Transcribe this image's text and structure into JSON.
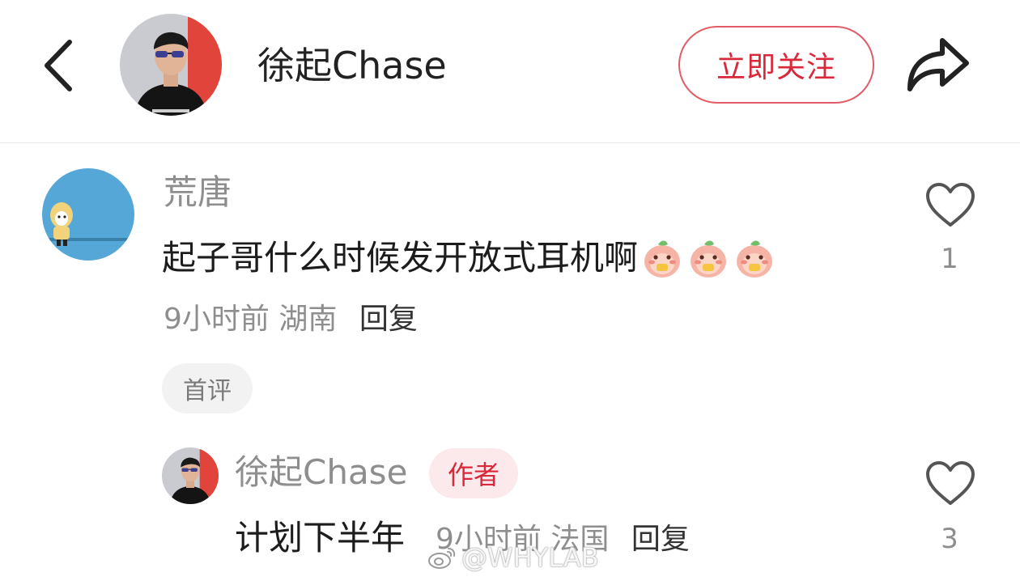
{
  "header": {
    "author_name": "徐起Chase",
    "follow_label": "立即关注"
  },
  "comments": [
    {
      "user": "荒唐",
      "text": "起子哥什么时候发开放式耳机啊",
      "emoji_count": 3,
      "time": "9小时前",
      "location": "湖南",
      "reply_label": "回复",
      "tag": "首评",
      "likes": "1"
    }
  ],
  "reply": {
    "user": "徐起Chase",
    "badge": "作者",
    "text": "计划下半年",
    "time": "9小时前",
    "location": "法国",
    "reply_label": "回复",
    "likes": "3"
  },
  "watermark": "@WHYLAB",
  "colors": {
    "accent": "#d8283a",
    "muted_text": "#8e8e8e",
    "badge_bg": "#fbe9ec"
  }
}
